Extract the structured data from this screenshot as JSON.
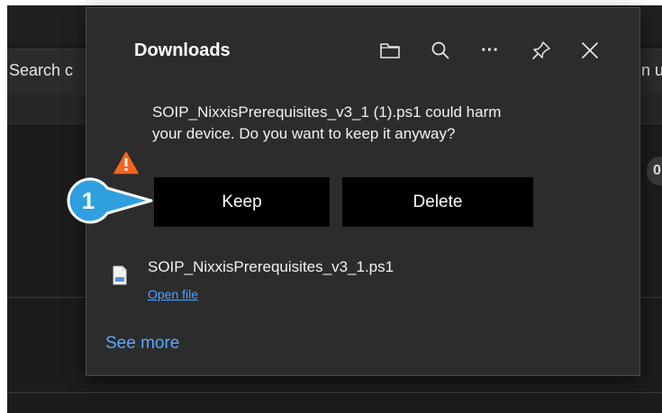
{
  "background": {
    "search_text": "Search c",
    "right_text": "n u",
    "chip_text": "0"
  },
  "downloads": {
    "title": "Downloads",
    "header_icons": [
      "folder-icon",
      "search-icon",
      "more-icon",
      "pin-icon",
      "close-icon"
    ],
    "more_glyph": "···",
    "warning": {
      "message": "SOIP_NixxisPrerequisites_v3_1 (1).ps1 could harm your device. Do you want to keep it anyway?",
      "keep_label": "Keep",
      "delete_label": "Delete"
    },
    "file": {
      "name": "SOIP_NixxisPrerequisites_v3_1.ps1",
      "open_label": "Open file"
    },
    "see_more_label": "See more"
  },
  "callout": {
    "number": "1",
    "color": "#2f9fe0"
  },
  "colors": {
    "flyout_bg": "#2c2c2c",
    "button_bg": "#000000",
    "link": "#4ea1ff",
    "warning": "#f5651f"
  }
}
